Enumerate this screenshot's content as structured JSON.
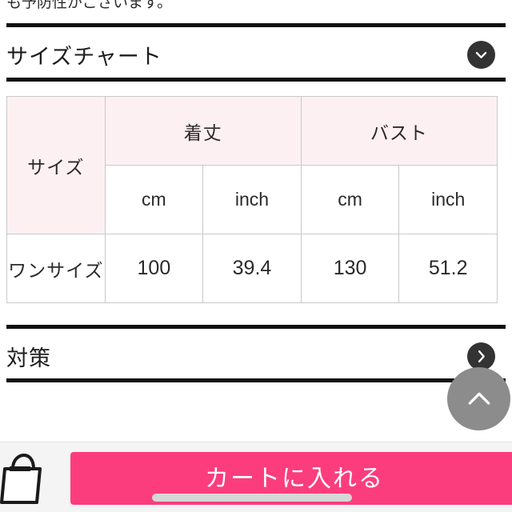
{
  "top_partial_text": "も予防性がございます。",
  "sections": [
    {
      "title": "サイズチャート",
      "icon": "chevron-down-icon",
      "expanded": true
    },
    {
      "title": "対策",
      "icon": "chevron-right-icon",
      "expanded": false
    }
  ],
  "size_chart": {
    "row_header_label": "サイズ",
    "measurement_groups": [
      "着丈",
      "バスト"
    ],
    "units": [
      "cm",
      "inch",
      "cm",
      "inch"
    ],
    "rows": [
      {
        "size": "ワンサイズ",
        "length_cm": "100",
        "length_inch": "39.4",
        "bust_cm": "130",
        "bust_inch": "51.2"
      }
    ]
  },
  "scroll_to_top": {
    "icon": "chevron-up-icon",
    "label": ""
  },
  "bottom_bar": {
    "bag_icon": "shopping-bag-icon",
    "cart_label": "カートに入れる"
  },
  "colors": {
    "accent_pink": "#fb3d7e",
    "header_pink": "#fdf0f3",
    "rule_black": "#111111",
    "circle_dark": "#333333",
    "scroll_gray": "#8c8c8c",
    "bar_background": "#f4f4f4",
    "border_gray": "#c9c9c9"
  }
}
